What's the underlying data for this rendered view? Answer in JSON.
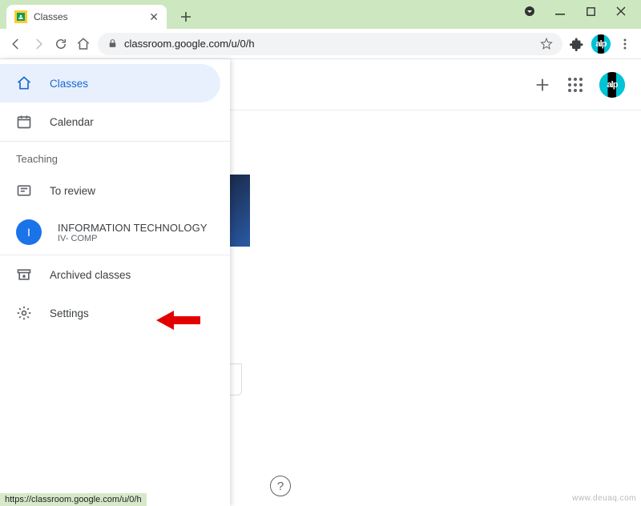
{
  "window": {
    "tab": {
      "title": "Classes"
    },
    "url": "classroom.google.com/u/0/h"
  },
  "toolbar_avatar_text": "alp",
  "app_header": {
    "avatar_text": "alp"
  },
  "sidebar": {
    "classes": "Classes",
    "calendar": "Calendar",
    "section_teaching": "Teaching",
    "to_review": "To review",
    "archived": "Archived classes",
    "settings": "Settings",
    "class": {
      "initial": "I",
      "name": "INFORMATION TECHNOLOGY",
      "section": "IV- COMP"
    }
  },
  "status_url": "https://classroom.google.com/u/0/h",
  "watermark": "www.deuaq.com"
}
